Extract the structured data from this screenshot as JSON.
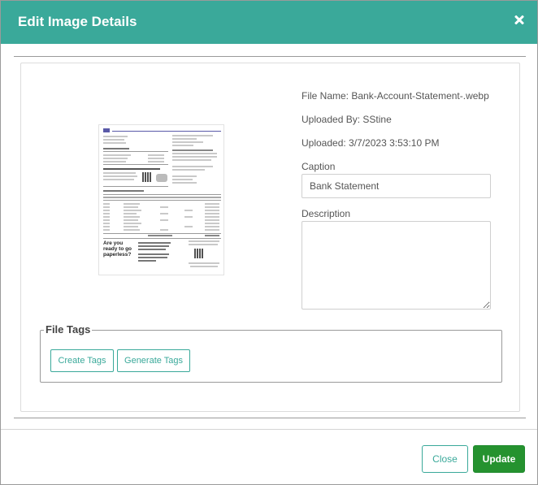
{
  "modal": {
    "title": "Edit Image Details",
    "header_color": "#3aa99a"
  },
  "file": {
    "name_line": "File Name: Bank-Account-Statement-.webp",
    "uploaded_by_line": "Uploaded By: SStine",
    "uploaded_line": "Uploaded: 3/7/2023 3:53:10 PM"
  },
  "preview": {
    "headline": "Are you ready to go paperless?"
  },
  "caption": {
    "label": "Caption",
    "value": "Bank Statement"
  },
  "description": {
    "label": "Description",
    "value": ""
  },
  "tags": {
    "legend": "File Tags",
    "create_label": "Create Tags",
    "generate_label": "Generate Tags"
  },
  "footer": {
    "close_label": "Close",
    "update_label": "Update",
    "update_color": "#25922f"
  }
}
